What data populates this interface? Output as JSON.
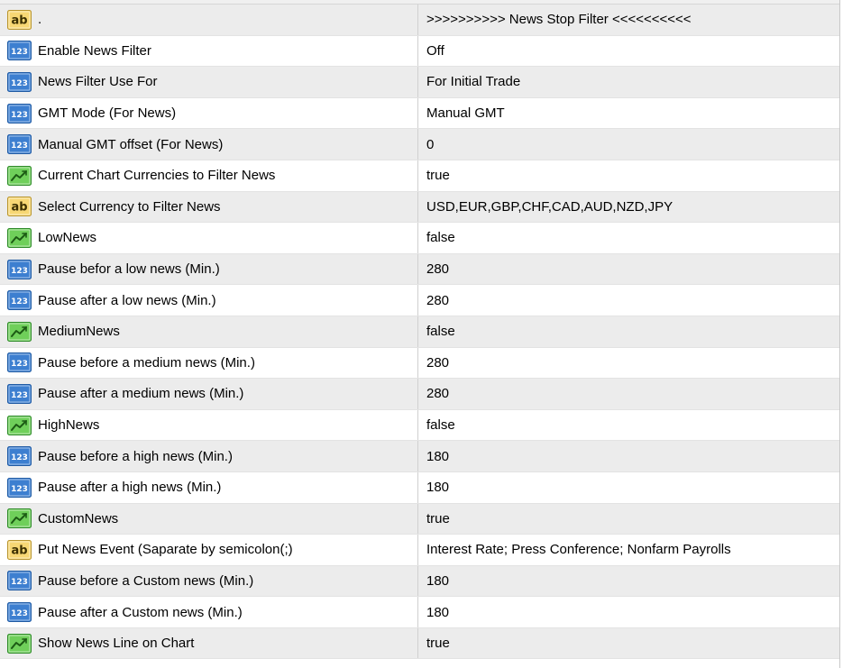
{
  "inputs": [
    {
      "icon": "ab",
      "name": ".",
      "value": ">>>>>>>>>> News Stop Filter <<<<<<<<<<"
    },
    {
      "icon": "123",
      "name": "Enable News Filter",
      "value": "Off"
    },
    {
      "icon": "123",
      "name": "News Filter Use For",
      "value": "For Initial Trade"
    },
    {
      "icon": "123",
      "name": "GMT Mode (For News)",
      "value": "Manual GMT"
    },
    {
      "icon": "123",
      "name": "Manual GMT offset (For News)",
      "value": "0"
    },
    {
      "icon": "bool",
      "name": "Current Chart Currencies to Filter News",
      "value": "true"
    },
    {
      "icon": "ab",
      "name": "Select Currency to Filter News",
      "value": "USD,EUR,GBP,CHF,CAD,AUD,NZD,JPY"
    },
    {
      "icon": "bool",
      "name": "LowNews",
      "value": "false"
    },
    {
      "icon": "123",
      "name": "Pause befor a low news (Min.)",
      "value": "280"
    },
    {
      "icon": "123",
      "name": "Pause after a low news (Min.)",
      "value": "280"
    },
    {
      "icon": "bool",
      "name": "MediumNews",
      "value": "false"
    },
    {
      "icon": "123",
      "name": "Pause before a medium news (Min.)",
      "value": "280"
    },
    {
      "icon": "123",
      "name": "Pause after a medium news (Min.)",
      "value": "280"
    },
    {
      "icon": "bool",
      "name": "HighNews",
      "value": "false"
    },
    {
      "icon": "123",
      "name": "Pause before a high news (Min.)",
      "value": "180"
    },
    {
      "icon": "123",
      "name": "Pause after a high news (Min.)",
      "value": "180"
    },
    {
      "icon": "bool",
      "name": "CustomNews",
      "value": "true"
    },
    {
      "icon": "ab",
      "name": "Put News Event (Saparate by semicolon(;)",
      "value": "Interest Rate; Press Conference; Nonfarm Payrolls"
    },
    {
      "icon": "123",
      "name": "Pause before a Custom news (Min.)",
      "value": "180"
    },
    {
      "icon": "123",
      "name": "Pause after a Custom news (Min.)",
      "value": "180"
    },
    {
      "icon": "bool",
      "name": "Show News Line on Chart",
      "value": "true"
    }
  ],
  "icon_types": {
    "ab": {
      "semantic": "string-type-icon",
      "glyph": "ab",
      "bg": "#f7d774",
      "border": "#b8952f",
      "text": "#3b2f00"
    },
    "123": {
      "semantic": "integer-type-icon",
      "glyph": "123",
      "bg": "#3d7fd0",
      "border": "#1f5aa3",
      "text": "#ffffff"
    },
    "bool": {
      "semantic": "boolean-type-icon",
      "glyph": "",
      "bg": "#6fcf5a",
      "border": "#2f8a2a",
      "text": "#1c5a14"
    }
  }
}
